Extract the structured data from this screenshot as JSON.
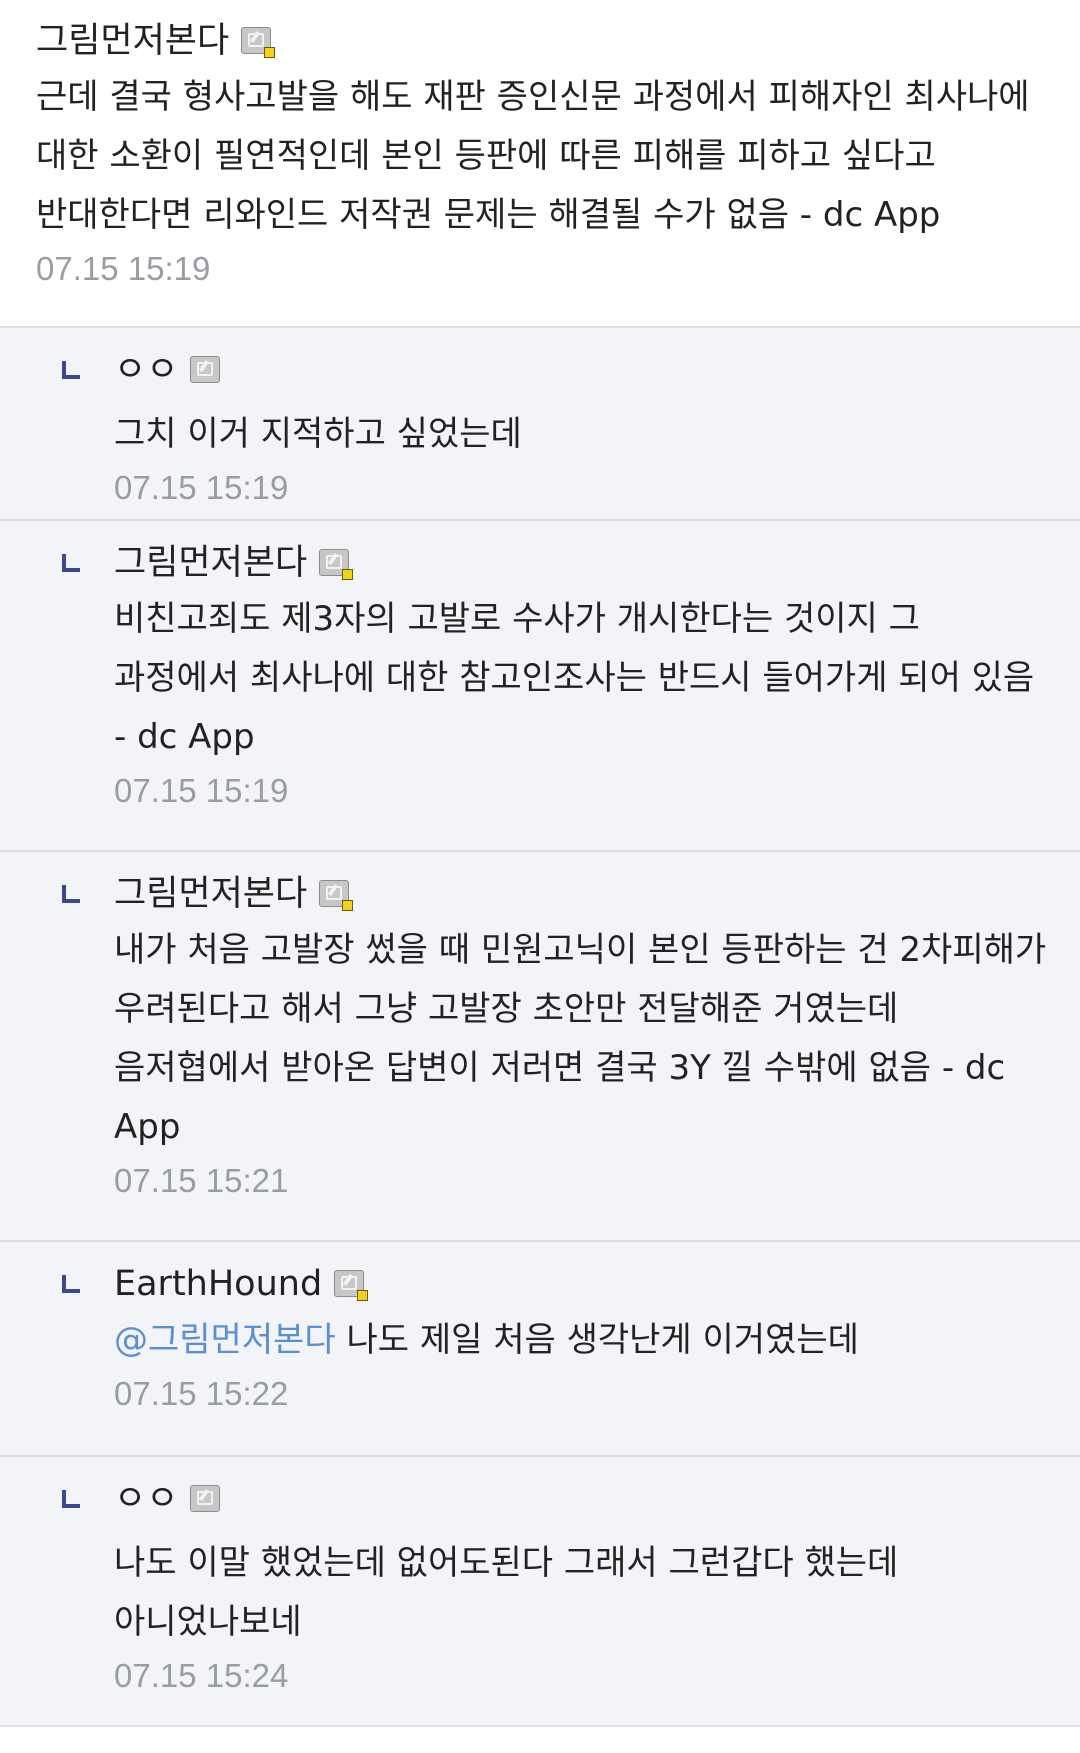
{
  "comments": [
    {
      "nick": "그림먼저본다",
      "text": "근데 결국 형사고발을 해도 재판 증인신문 과정에서 피해자인 최사나에 대한 소환이 필연적인데 본인 등판에 따른 피해를 피하고 싶다고 반대한다면 리와인드 저작권 문제는 해결될 수가 없음 - dc App",
      "time": "07.15 15:19"
    }
  ],
  "replies": [
    {
      "nick": "ㅇㅇ",
      "text": "그치 이거 지적하고 싶었는데",
      "time": "07.15 15:19"
    },
    {
      "nick": "그림먼저본다",
      "text": "비친고죄도 제3자의 고발로 수사가 개시한다는 것이지 그 과정에서 최사나에 대한 참고인조사는 반드시 들어가게 되어 있음 - dc App",
      "time": "07.15 15:19"
    },
    {
      "nick": "그림먼저본다",
      "text": "내가 처음 고발장 썼을 때 민원고닉이 본인 등판하는 건 2차피해가 우려된다고 해서 그냥 고발장 초안만 전달해준 거였는데 음저협에서 받아온 답변이 저러면 결국 3Y 낄 수밖에 없음 - dc App",
      "time": "07.15 15:21"
    },
    {
      "nick": "EarthHound",
      "mention": "@그림먼저본다",
      "text": " 나도 제일 처음 생각난게 이거였는데",
      "time": "07.15 15:22"
    },
    {
      "nick": "ㅇㅇ",
      "text": "나도 이말 했었는데 없어도된다 그래서 그런갑다 했는데 아니었나보네",
      "time": "07.15 15:24"
    }
  ],
  "colors": {
    "reply_bg": "#f3f4f8",
    "reply_arrow": "#3b4890",
    "mention": "#5a8ed6",
    "timestamp": "#9a9ca3"
  },
  "icons": {
    "member_badge": "member-icon",
    "reply_marker": "reply-arrow-icon"
  }
}
